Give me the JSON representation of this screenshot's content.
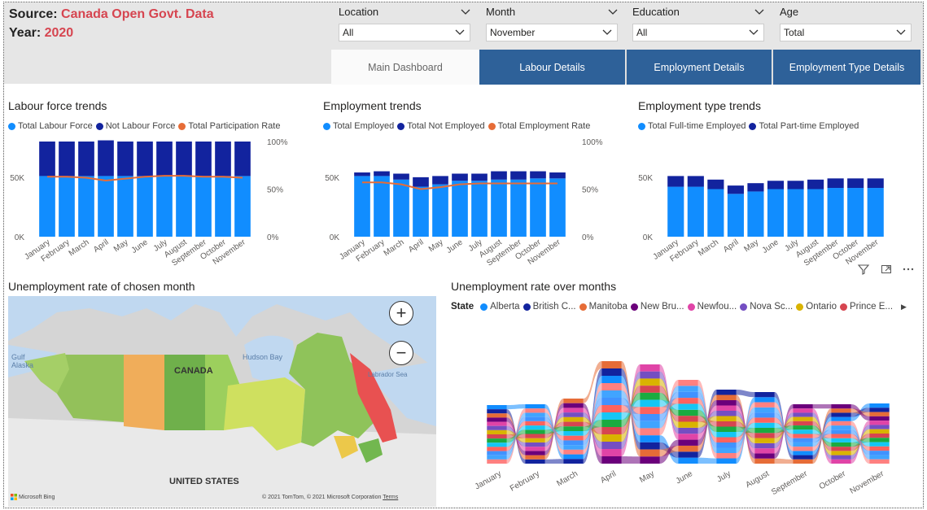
{
  "source": {
    "label": "Source:",
    "value": "Canada Open Govt. Data"
  },
  "year": {
    "label": "Year:",
    "value": "2020"
  },
  "slicers": [
    {
      "label": "Location",
      "value": "All"
    },
    {
      "label": "Month",
      "value": "November"
    },
    {
      "label": "Education",
      "value": "All"
    },
    {
      "label": "Age",
      "value": "Total"
    }
  ],
  "tabs": [
    "Main Dashboard",
    "Labour Details",
    "Employment Details",
    "Employment Type Details"
  ],
  "months": [
    "January",
    "February",
    "March",
    "April",
    "May",
    "June",
    "July",
    "August",
    "September",
    "October",
    "November"
  ],
  "chart_data": [
    {
      "type": "bar",
      "title": "Labour force trends",
      "categories": [
        "January",
        "February",
        "March",
        "April",
        "May",
        "June",
        "July",
        "August",
        "September",
        "October",
        "November"
      ],
      "series": [
        {
          "name": "Total Labour Force",
          "values": [
            51,
            51,
            51,
            51,
            51,
            51,
            51,
            51,
            51,
            51,
            51
          ],
          "color": "#118dff"
        },
        {
          "name": "Not Labour Force",
          "values": [
            29,
            29,
            29,
            30,
            29,
            29,
            29,
            29,
            29,
            29,
            29
          ],
          "color": "#12239e"
        },
        {
          "name": "Total Participation Rate",
          "values": [
            63,
            63,
            62,
            59,
            61,
            63,
            64,
            64,
            63,
            63,
            62
          ],
          "color": "#e66c37"
        }
      ],
      "y_ticks": [
        "0K",
        "50K"
      ],
      "y2_ticks": [
        "0%",
        "50%",
        "100%"
      ]
    },
    {
      "type": "bar",
      "title": "Employment trends",
      "categories": [
        "January",
        "February",
        "March",
        "April",
        "May",
        "June",
        "July",
        "August",
        "September",
        "October",
        "November"
      ],
      "series": [
        {
          "name": "Total Employed",
          "values": [
            51,
            51,
            48,
            42,
            44,
            47,
            47,
            48,
            48,
            49,
            49
          ],
          "color": "#118dff"
        },
        {
          "name": "Total Not Employed",
          "values": [
            3,
            4,
            5,
            8,
            7,
            6,
            6,
            7,
            7,
            6,
            5
          ],
          "color": "#12239e"
        },
        {
          "name": "Total Employment Rate",
          "values": [
            57,
            57,
            55,
            50,
            52,
            55,
            56,
            56,
            56,
            56,
            56
          ],
          "color": "#e66c37"
        }
      ],
      "y_ticks": [
        "0K",
        "50K"
      ],
      "y2_ticks": [
        "0%",
        "50%",
        "100%"
      ]
    },
    {
      "type": "bar",
      "title": "Employment type trends",
      "categories": [
        "January",
        "February",
        "March",
        "April",
        "May",
        "June",
        "July",
        "August",
        "September",
        "October",
        "November"
      ],
      "series": [
        {
          "name": "Total Full-time Employed",
          "values": [
            42,
            42,
            40,
            36,
            38,
            40,
            40,
            40,
            41,
            41,
            41
          ],
          "color": "#118dff"
        },
        {
          "name": "Total Part-time Employed",
          "values": [
            9,
            9,
            8,
            7,
            7,
            7,
            7,
            8,
            8,
            8,
            8
          ],
          "color": "#12239e"
        }
      ],
      "y_ticks": [
        "0K",
        "50K"
      ]
    },
    {
      "type": "area",
      "title": "Unemployment rate over months",
      "legend_title": "State",
      "categories": [
        "January",
        "February",
        "March",
        "April",
        "May",
        "June",
        "July",
        "August",
        "September",
        "October",
        "November"
      ],
      "series": [
        {
          "name": "Alberta",
          "color": "#118dff"
        },
        {
          "name": "British C...",
          "color": "#12239e"
        },
        {
          "name": "Manitoba",
          "color": "#e66c37"
        },
        {
          "name": "New Bru...",
          "color": "#6b007b"
        },
        {
          "name": "Newfou...",
          "color": "#e044a7"
        },
        {
          "name": "Nova Sc...",
          "color": "#744ec2"
        },
        {
          "name": "Ontario",
          "color": "#d9b300"
        },
        {
          "name": "Prince E...",
          "color": "#d64550"
        }
      ]
    }
  ],
  "map": {
    "title": "Unemployment rate of chosen month",
    "labels": {
      "canada": "CANADA",
      "us": "UNITED STATES",
      "hudson": "Hudson Bay",
      "labrador": "Labrador Sea",
      "gulf": "Gulf\nAlaska"
    },
    "attribution": "© 2021 TomTom, © 2021 Microsoft Corporation",
    "terms": "Terms",
    "bing": "Microsoft Bing"
  }
}
